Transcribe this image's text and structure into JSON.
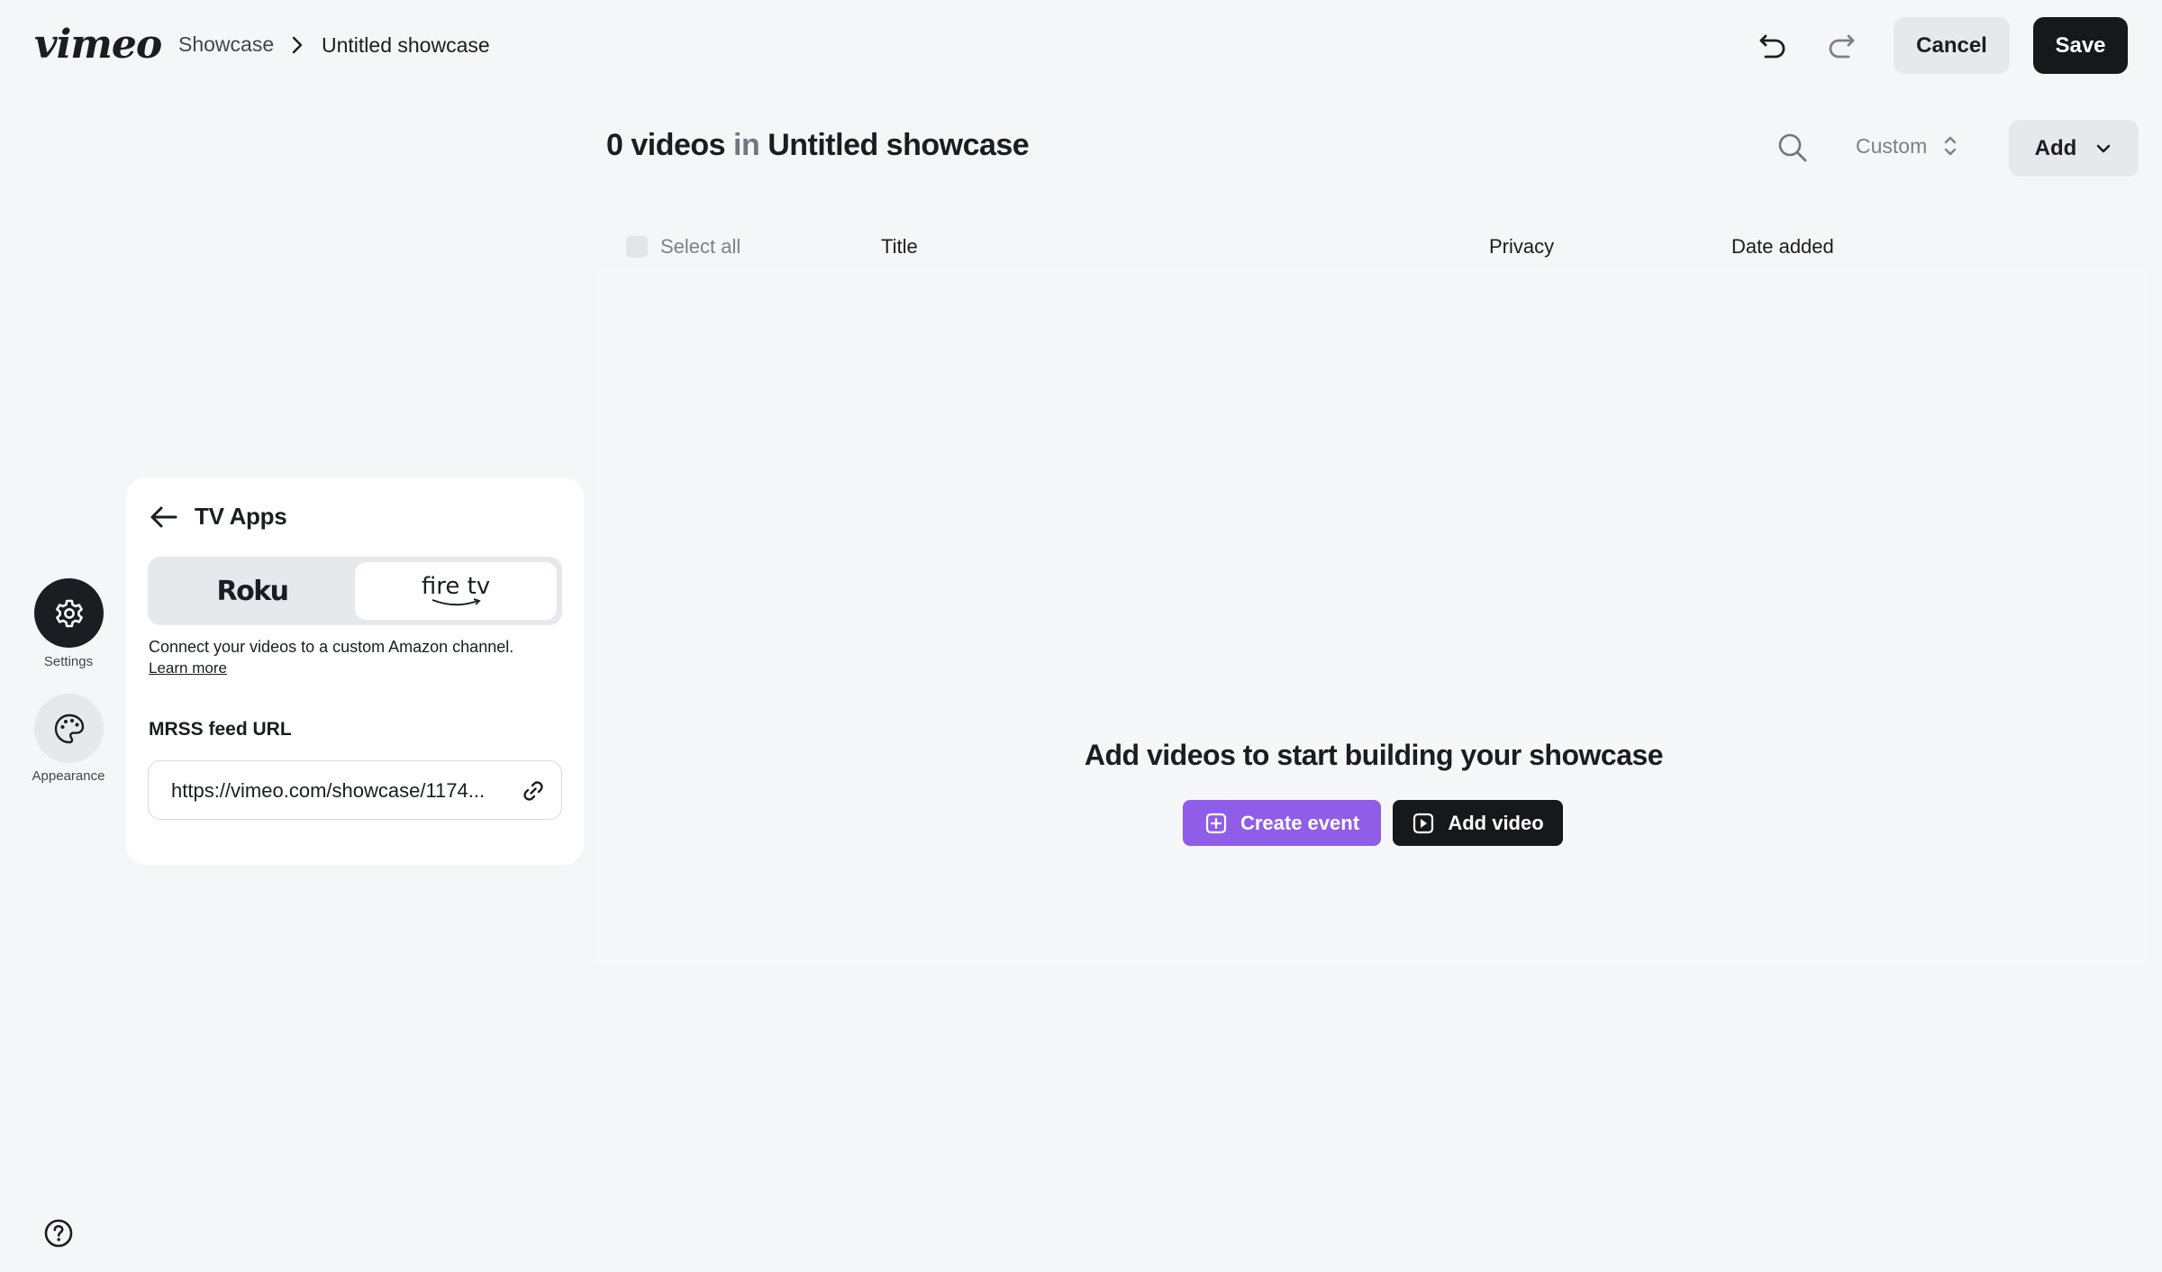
{
  "brand": {
    "logo_text": "vimeo"
  },
  "breadcrumb": {
    "parent": "Showcase",
    "current": "Untitled showcase"
  },
  "header": {
    "cancel_label": "Cancel",
    "save_label": "Save"
  },
  "main": {
    "count": "0 videos",
    "in_word": "in",
    "showcase_name": "Untitled showcase",
    "sort_label": "Custom",
    "add_label": "Add"
  },
  "table": {
    "select_all": "Select all",
    "columns": [
      "Title",
      "Privacy",
      "Date added"
    ]
  },
  "empty_state": {
    "title": "Add videos to start building your showcase",
    "create_event_label": "Create event",
    "add_video_label": "Add video"
  },
  "rail": {
    "settings_label": "Settings",
    "appearance_label": "Appearance"
  },
  "panel": {
    "title": "TV Apps",
    "tabs": [
      "Roku",
      "fire tv"
    ],
    "selected_tab": "fire tv",
    "description": "Connect your videos to a custom Amazon channel.",
    "learn_more": "Learn more",
    "mrss_label": "MRSS feed URL",
    "mrss_value": "https://vimeo.com/showcase/1174..."
  },
  "colors": {
    "accent_purple": "#8f5de8",
    "dark": "#16181b",
    "background": "#f5f6f8"
  }
}
